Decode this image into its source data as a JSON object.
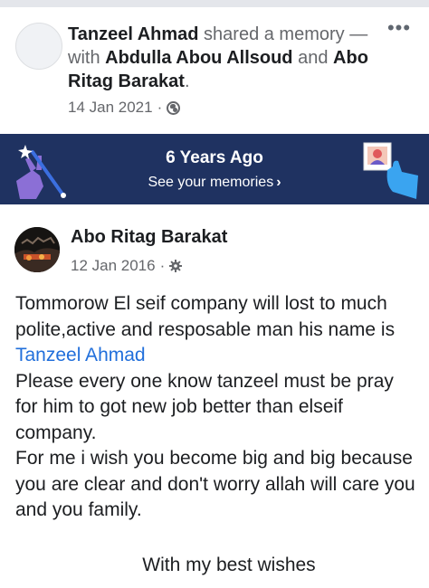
{
  "share_header": {
    "sharer": "Tanzeel Ahmad",
    "action_text": "shared a memory — with",
    "tagged_1": "Abdulla Abou Allsoud",
    "conjunction": "and",
    "tagged_2": "Abo Ritag Barakat",
    "end_punct": ".",
    "date": "14 Jan 2021",
    "sep": "·",
    "privacy_icon": "globe-icon",
    "more_label": "•••"
  },
  "memory_banner": {
    "title": "6 Years Ago",
    "link_label": "See your memories",
    "link_chevron": "›",
    "background": "#1f3261"
  },
  "post": {
    "author": "Abo Ritag Barakat",
    "date": "12 Jan 2016",
    "sep": "·",
    "privacy_icon": "gear-icon",
    "line1_before": "Tommorow El seif company will lost to much polite,active and resposable man his name is",
    "mention": "Tanzeel Ahmad",
    "line2": "Please every one know tanzeel must be pray for him to got new job better than elseif company.",
    "line3": "For me i wish you become big and big because you are clear and don't worry allah will care you and you family.",
    "sign_off": "With my best wishes"
  },
  "colors": {
    "link_blue": "#216fdb",
    "secondary_text": "#65676b",
    "primary_text": "#1c1e21"
  }
}
